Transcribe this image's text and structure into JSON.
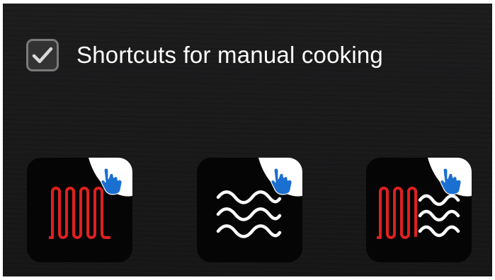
{
  "settings": {
    "shortcuts_option": {
      "label": "Shortcuts for manual cooking",
      "checked": true
    }
  },
  "shortcuts": [
    {
      "icon": "heating-element-icon"
    },
    {
      "icon": "steam-icon"
    },
    {
      "icon": "combi-heat-steam-icon"
    }
  ],
  "colors": {
    "background": "#1a1a1b",
    "tile": "#050505",
    "heating_red": "#e02020",
    "steam_white": "#ffffff",
    "touch_blue": "#1b6fd1",
    "checkbox_border": "#7a7a7a",
    "text": "#ffffff"
  }
}
